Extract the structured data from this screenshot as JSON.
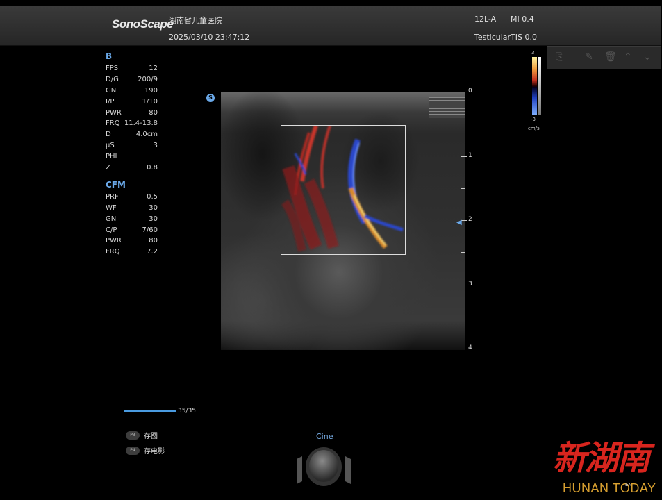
{
  "header": {
    "logo": "SonoScape",
    "hospital": "湖南省儿童医院",
    "datetime": "2025/03/10 23:47:12",
    "probe": "12L-A",
    "preset": "Testicular",
    "mi": "MI 0.4",
    "tis": "TIS 0.0"
  },
  "b_mode": {
    "title": "B",
    "params": [
      {
        "name": "FPS",
        "value": "12"
      },
      {
        "name": "D/G",
        "value": "200/9"
      },
      {
        "name": "GN",
        "value": "190"
      },
      {
        "name": "I/P",
        "value": "1/10"
      },
      {
        "name": "PWR",
        "value": "80"
      },
      {
        "name": "FRQ",
        "value": "11.4-13.8"
      },
      {
        "name": "D",
        "value": "4.0cm"
      },
      {
        "name": "μS",
        "value": "3"
      },
      {
        "name": "PHI",
        "value": ""
      },
      {
        "name": "Z",
        "value": "0.8"
      }
    ]
  },
  "cfm_mode": {
    "title": "CFM",
    "params": [
      {
        "name": "PRF",
        "value": "0.5"
      },
      {
        "name": "WF",
        "value": "30"
      },
      {
        "name": "GN",
        "value": "30"
      },
      {
        "name": "C/P",
        "value": "7/60"
      },
      {
        "name": "PWR",
        "value": "80"
      },
      {
        "name": "FRQ",
        "value": "7.2"
      }
    ]
  },
  "orientation_marker": "S",
  "depth_scale": {
    "labels": [
      "0",
      "1",
      "2",
      "3",
      "4"
    ],
    "focus_depth": 2
  },
  "color_scale": {
    "top": "3",
    "bottom": "-3",
    "unit": "cm/s",
    "colors": {
      "positive": "#f0a040",
      "negative": "#2040c0"
    }
  },
  "toolbar": {
    "icons": [
      "edit-copy-icon",
      "edit-icon",
      "trash-icon",
      "chevron-up-icon",
      "chevron-down-icon"
    ]
  },
  "cine": {
    "label": "Cine",
    "progress": "35/35",
    "progress_fraction": 1.0
  },
  "keys": [
    {
      "badge": "P3",
      "label": "存图"
    },
    {
      "badge": "P4",
      "label": "存电影"
    }
  ],
  "watermark": {
    "cn": "新湖南",
    "en": "HUNAN TODAY"
  },
  "status": {
    "lang": "EN"
  }
}
